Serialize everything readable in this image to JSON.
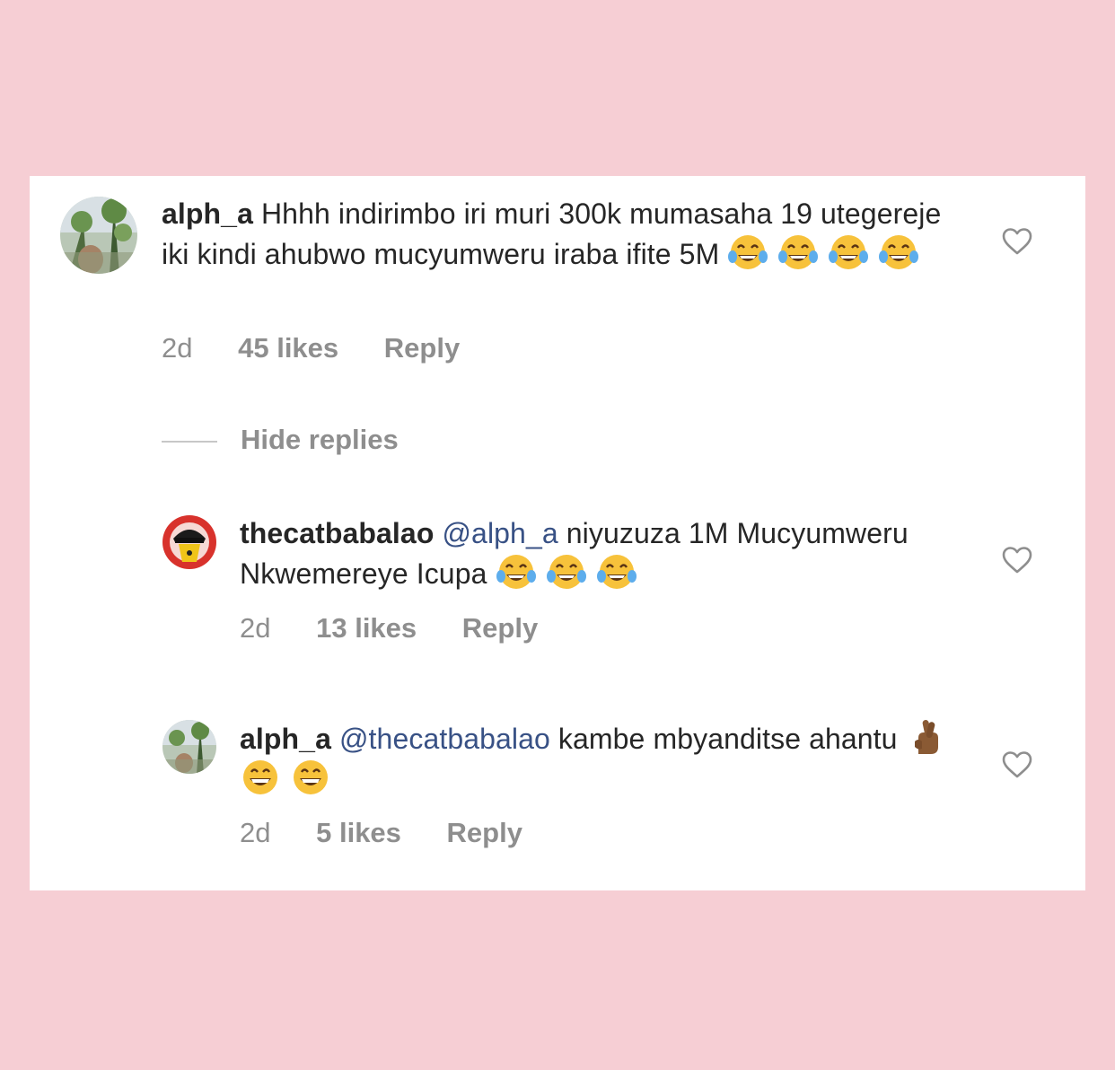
{
  "comments": [
    {
      "username": "alph_a",
      "mention": "",
      "text": " Hhhh indirimbo iri muri 300k mumasaha 19 utegereje iki kindi ahubwo mucyumweru iraba ifite 5M",
      "emojis": [
        "tears-of-joy",
        "tears-of-joy",
        "tears-of-joy",
        "tears-of-joy"
      ],
      "time": "2d",
      "likes": "45 likes",
      "reply": "Reply"
    },
    {
      "username": "thecatbabalao",
      "mention": " @alph_a",
      "text": " niyuzuza 1M Mucyumweru Nkwemereye Icupa",
      "emojis": [
        "tears-of-joy",
        "tears-of-joy",
        "tears-of-joy"
      ],
      "time": "2d",
      "likes": "13 likes",
      "reply": "Reply"
    },
    {
      "username": "alph_a",
      "mention": " @thecatbabalao",
      "text": " kambe mbyanditse ahantu",
      "emojis": [
        "crossed-fingers",
        "grinning-face",
        "grinning-face"
      ],
      "time": "2d",
      "likes": "5 likes",
      "reply": "Reply"
    }
  ],
  "hide_replies": "Hide replies",
  "colors": {
    "background": "#f6ced4",
    "card": "#ffffff",
    "text": "#262626",
    "muted": "#8e8e8e",
    "mention": "#385185"
  },
  "icons": {
    "like": "heart-outline-icon"
  }
}
